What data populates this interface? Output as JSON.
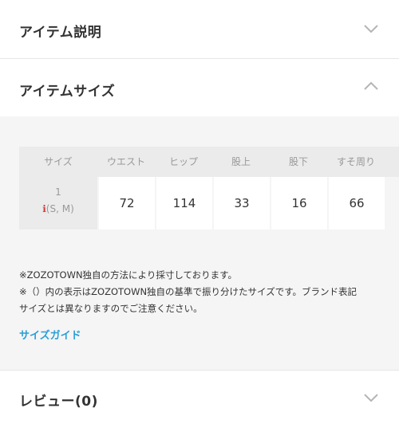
{
  "sections": {
    "item_description": {
      "title": "アイテム説明",
      "state": "collapsed"
    },
    "item_size": {
      "title": "アイテムサイズ",
      "state": "expanded"
    },
    "reviews": {
      "title": "レビュー(0)",
      "state": "collapsed"
    }
  },
  "size_table": {
    "headers": [
      "サイズ",
      "ウエスト",
      "ヒップ",
      "股上",
      "股下",
      "すそ周り"
    ],
    "rows": [
      {
        "size": "1",
        "size_note": "(S, M)",
        "values": [
          "72",
          "114",
          "33",
          "16",
          "66"
        ]
      }
    ]
  },
  "notes": {
    "line1": "※ZOZOTOWN独自の方法により採寸しております。",
    "line2": "※（）内の表示はZOZOTOWN独自の基準で振り分けたサイズです。ブランド表記",
    "line3": "サイズとは異なりますのでご注意ください。"
  },
  "size_guide_link": "サイズガイド",
  "colors": {
    "link": "#2a9fd6",
    "panel_bg": "#f5f5f5",
    "header_cell_bg": "#ebebeb",
    "info_icon": "#d63a3a"
  }
}
